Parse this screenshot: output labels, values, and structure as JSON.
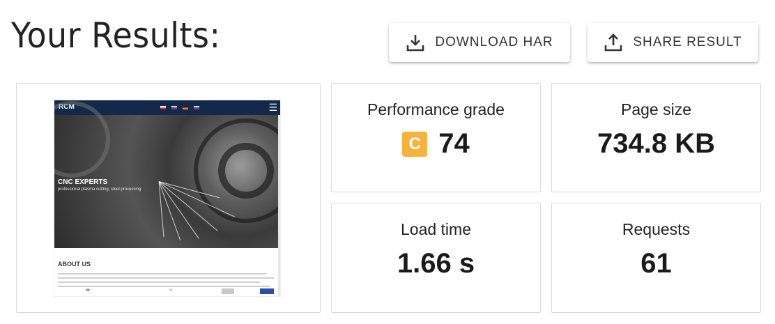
{
  "header": {
    "title": "Your Results:"
  },
  "actions": {
    "download_label": "DOWNLOAD HAR",
    "share_label": "SHARE RESULT"
  },
  "screenshot": {
    "logo": "RCM",
    "hero_title": "CNC EXPERTS",
    "hero_subtitle": "professional plasma cutting, steel processing",
    "section_title": "ABOUT US"
  },
  "metrics": {
    "performance": {
      "label": "Performance grade",
      "grade": "C",
      "score": "74",
      "grade_color": "#f7b23b"
    },
    "page_size": {
      "label": "Page size",
      "value": "734.8 KB"
    },
    "load_time": {
      "label": "Load time",
      "value": "1.66 s"
    },
    "requests": {
      "label": "Requests",
      "value": "61"
    }
  }
}
